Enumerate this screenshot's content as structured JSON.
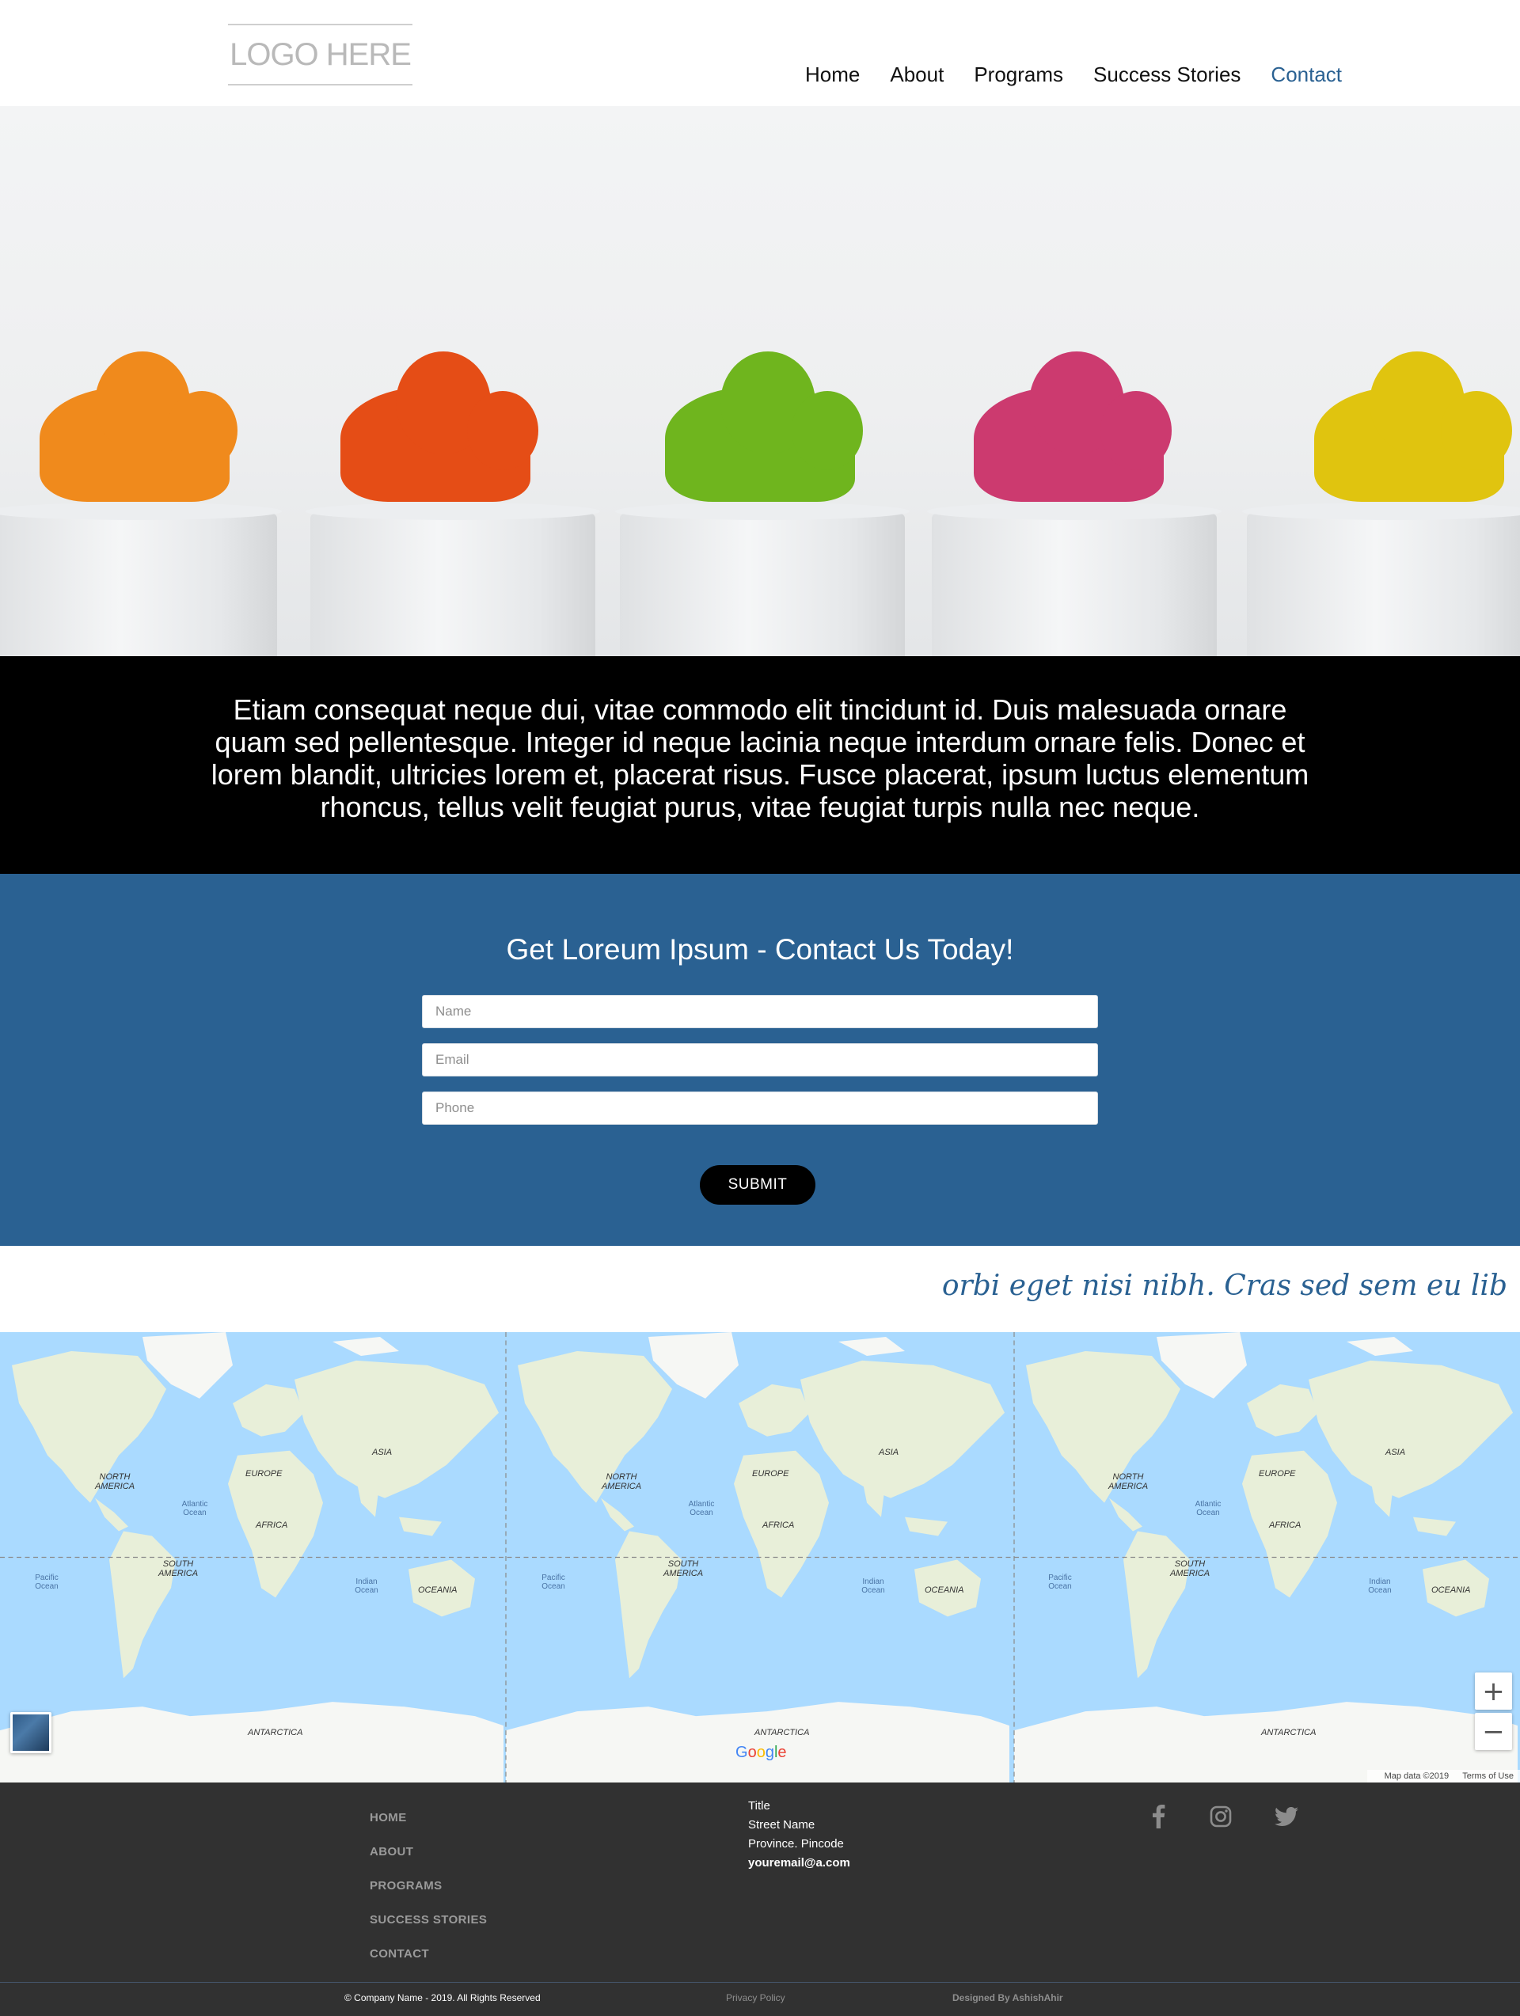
{
  "header": {
    "logo_text": "LOGO HERE",
    "nav": [
      {
        "label": "Home",
        "active": false
      },
      {
        "label": "About",
        "active": false
      },
      {
        "label": "Programs",
        "active": false
      },
      {
        "label": "Success Stories",
        "active": false
      },
      {
        "label": "Contact",
        "active": true
      }
    ]
  },
  "hero": {
    "cactus_colors": [
      "#f08a1c",
      "#e54d16",
      "#6fb51e",
      "#cc3a6f",
      "#e0c40f"
    ]
  },
  "intro": {
    "text": "Etiam consequat neque dui, vitae commodo elit tincidunt id. Duis malesuada ornare quam sed pellentesque. Integer id neque lacinia neque interdum ornare felis. Donec et lorem blandit, ultricies lorem et, placerat risus. Fusce placerat, ipsum luctus elementum rhoncus, tellus velit feugiat purus, vitae feugiat turpis nulla nec neque."
  },
  "contact": {
    "heading": "Get Loreum Ipsum - Contact Us Today!",
    "name_placeholder": "Name",
    "email_placeholder": "Email",
    "phone_placeholder": "Phone",
    "submit_label": "SUBMIT"
  },
  "marquee": {
    "text": "orbi eget nisi nibh. Cras sed sem eu lib"
  },
  "map": {
    "continents": [
      "NORTH AMERICA",
      "EUROPE",
      "ASIA",
      "AFRICA",
      "SOUTH AMERICA",
      "OCEANIA",
      "ANTARCTICA"
    ],
    "oceans": [
      "Atlantic Ocean",
      "Pacific Ocean",
      "Indian Ocean"
    ],
    "zoom_in": "+",
    "zoom_out": "−",
    "attribution": "Map data ©2019",
    "terms": "Terms of Use",
    "google_logo": "Google"
  },
  "footer": {
    "links": [
      "HOME",
      "ABOUT",
      "PROGRAMS",
      "SUCCESS STORIES",
      "CONTACT"
    ],
    "address": {
      "title": "Title",
      "street": "Street Name",
      "province": "Province. Pincode",
      "email": "youremail@a.com"
    },
    "social": [
      "facebook-icon",
      "instagram-icon",
      "twitter-icon"
    ],
    "copyright": "© Company Name - 2019. All Rights Reserved",
    "privacy": "Privacy Policy",
    "designed_by": "Designed By AshishAhir"
  },
  "colors": {
    "brand_blue": "#2a6192",
    "footer_bg": "#313131",
    "map_water": "#aadaff",
    "map_land": "#e8efd9"
  }
}
